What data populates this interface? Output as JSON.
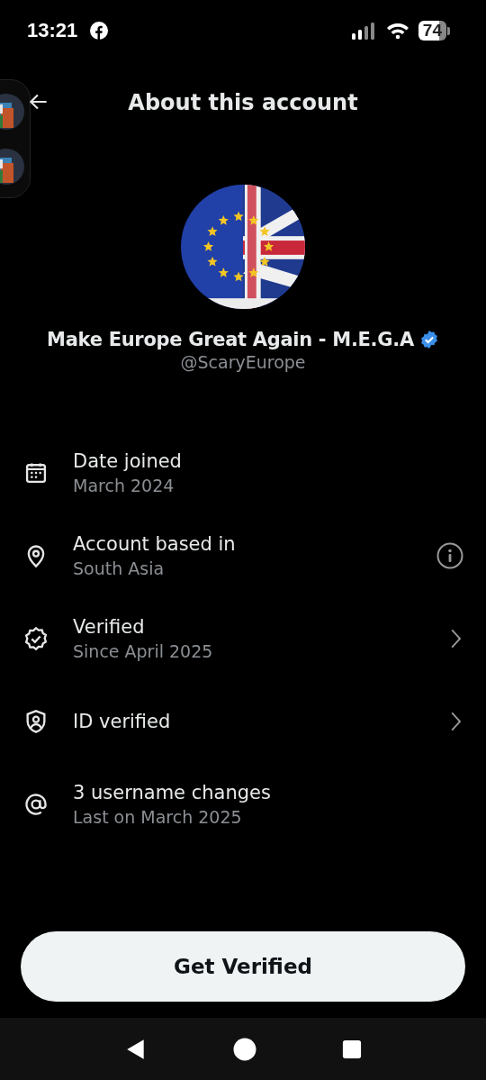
{
  "status_bar": {
    "time": "13:21",
    "battery": "74"
  },
  "header": {
    "title": "About this account"
  },
  "profile": {
    "name": "Make Europe Great Again - M.E.G.A",
    "verified": true,
    "handle": "@ScaryEurope"
  },
  "details": [
    {
      "kind": "date",
      "label": "Date joined",
      "value": "March 2024"
    },
    {
      "kind": "location",
      "label": "Account based in",
      "value": "South Asia",
      "trailing": {
        "kind": "info"
      }
    },
    {
      "kind": "verified",
      "label": "Verified",
      "value": "Since April 2025",
      "trailing": {
        "kind": "chevron"
      }
    },
    {
      "kind": "id",
      "label": "ID verified",
      "trailing": {
        "kind": "chevron"
      }
    },
    {
      "kind": "username",
      "label": "3 username changes",
      "value": "Last on March 2025"
    }
  ],
  "primary_button": "Get Verified"
}
